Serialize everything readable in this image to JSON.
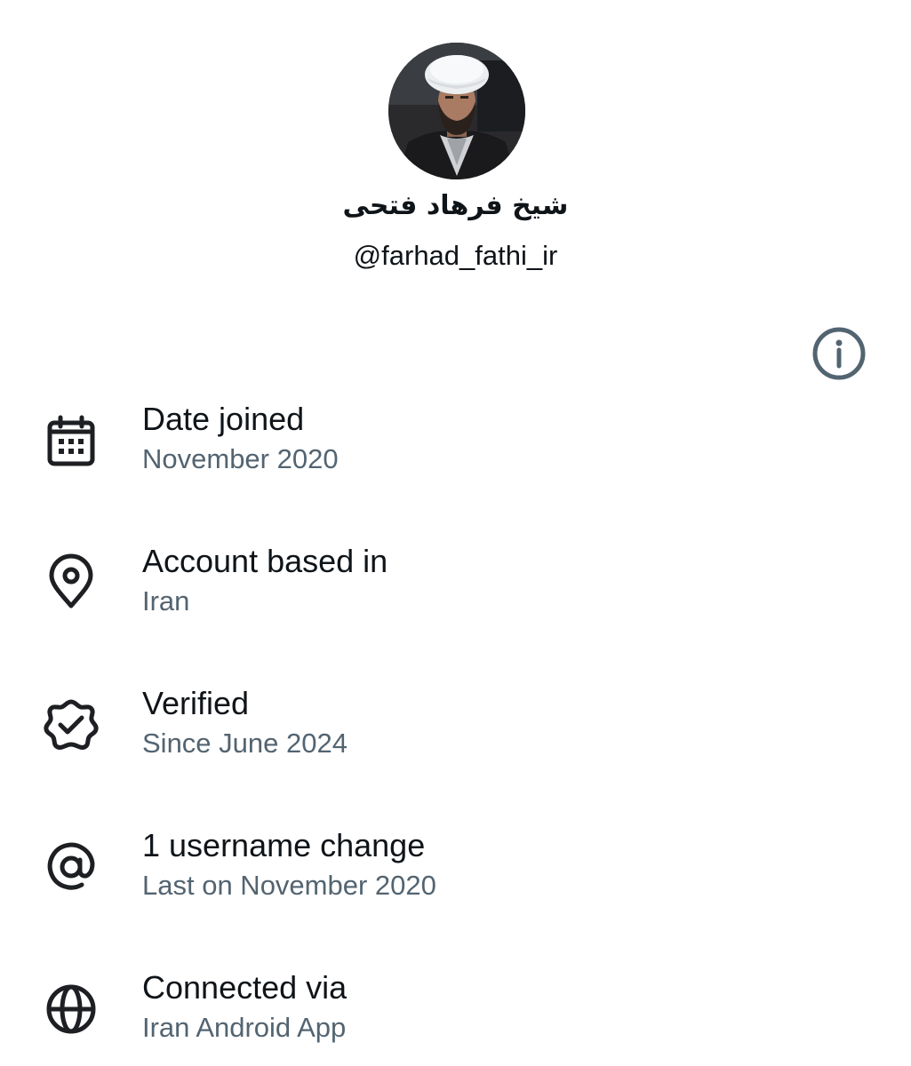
{
  "profile": {
    "display_name": "شیخ فرهاد فتحی",
    "handle": "@farhad_fathi_ir",
    "avatar": "profile-photo"
  },
  "about_items": [
    {
      "icon": "calendar-icon",
      "title": "Date joined",
      "subtitle": "November 2020"
    },
    {
      "icon": "location-pin-icon",
      "title": "Account based in",
      "subtitle": "Iran"
    },
    {
      "icon": "verified-badge-icon",
      "title": "Verified",
      "subtitle": "Since June 2024",
      "action_icon": "info-icon"
    },
    {
      "icon": "at-sign-icon",
      "title": "1 username change",
      "subtitle": "Last on November 2020"
    },
    {
      "icon": "globe-icon",
      "title": "Connected via",
      "subtitle": "Iran Android App"
    }
  ],
  "colors": {
    "primary_text": "#0f1419",
    "secondary_text": "#536471",
    "icon": "#1d1f22",
    "info_icon": "#536471",
    "background": "#ffffff"
  }
}
